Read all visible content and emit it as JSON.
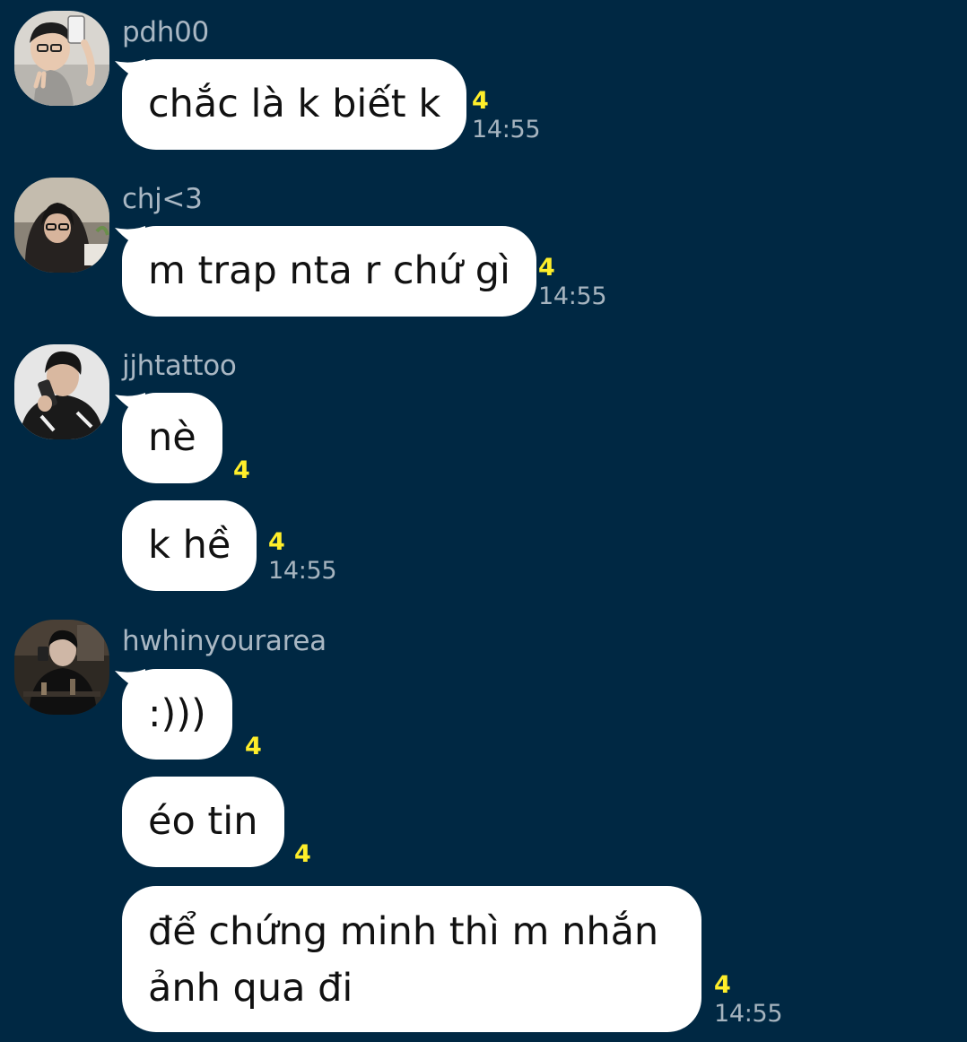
{
  "colors": {
    "background": "#002843",
    "bubble": "#ffffff",
    "unread_count": "#ffee2a",
    "timestamp": "#a6b4bf",
    "sender_name": "#a9b7c3"
  },
  "messages": [
    {
      "sender": "pdh00",
      "avatar_icon": "profile-photo",
      "bubbles": [
        {
          "text": "chắc là k biết k",
          "unread": "4",
          "time": "14:55"
        }
      ]
    },
    {
      "sender": "chj<3",
      "avatar_icon": "profile-photo",
      "bubbles": [
        {
          "text": "m trap nta r chứ gì",
          "unread": "4",
          "time": "14:55"
        }
      ]
    },
    {
      "sender": "jjhtattoo",
      "avatar_icon": "profile-photo",
      "bubbles": [
        {
          "text": "nè",
          "unread": "4",
          "time": ""
        },
        {
          "text": "k hề",
          "unread": "4",
          "time": "14:55"
        }
      ]
    },
    {
      "sender": "hwhinyourarea",
      "avatar_icon": "profile-photo",
      "bubbles": [
        {
          "text": ":)))",
          "unread": "4",
          "time": ""
        },
        {
          "text": "éo tin",
          "unread": "4",
          "time": ""
        },
        {
          "text": "để chứng minh thì m nhắn ảnh qua đi",
          "unread": "4",
          "time": "14:55"
        }
      ]
    }
  ]
}
